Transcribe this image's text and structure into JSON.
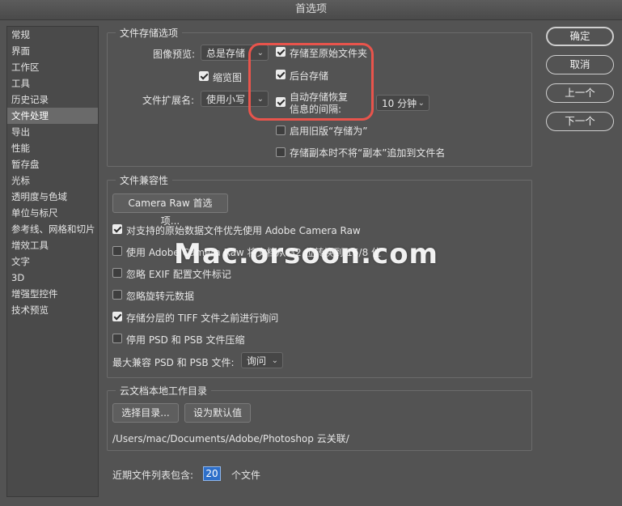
{
  "window": {
    "title": "首选项"
  },
  "sidebar": {
    "items": [
      {
        "label": "常规"
      },
      {
        "label": "界面"
      },
      {
        "label": "工作区"
      },
      {
        "label": "工具"
      },
      {
        "label": "历史记录"
      },
      {
        "label": "文件处理"
      },
      {
        "label": "导出"
      },
      {
        "label": "性能"
      },
      {
        "label": "暂存盘"
      },
      {
        "label": "光标"
      },
      {
        "label": "透明度与色域"
      },
      {
        "label": "单位与标尺"
      },
      {
        "label": "参考线、网格和切片"
      },
      {
        "label": "增效工具"
      },
      {
        "label": "文字"
      },
      {
        "label": "3D"
      },
      {
        "label": "增强型控件"
      },
      {
        "label": "技术预览"
      }
    ],
    "active_index": 5
  },
  "file_saving": {
    "title": "文件存储选项",
    "image_preview_label": "图像预览:",
    "image_preview_value": "总是存储",
    "thumbnail_label": "缩览图",
    "thumbnail_checked": true,
    "file_ext_label": "文件扩展名:",
    "file_ext_value": "使用小写",
    "save_original_folder_label": "存储至原始文件夹",
    "save_original_folder_checked": true,
    "background_save_label": "后台存储",
    "background_save_checked": true,
    "auto_save_label_line1": "自动存储恢复",
    "auto_save_label_line2": "信息的间隔:",
    "auto_save_checked": true,
    "auto_save_interval": "10 分钟",
    "legacy_save_as_label": "启用旧版“存储为”",
    "legacy_save_as_checked": false,
    "no_copy_suffix_label": "存储副本时不将“副本”追加到文件名",
    "no_copy_suffix_checked": false
  },
  "compat": {
    "title": "文件兼容性",
    "camera_raw_button": "Camera Raw 首选项...",
    "opt1_label": "对支持的原始数据文件优先使用 Adobe Camera Raw",
    "opt1_checked": true,
    "opt2_label": "使用 Adobe Camera Raw 将文档从 32 位转换到 16/8 位",
    "opt2_checked": false,
    "opt3_label": "忽略 EXIF 配置文件标记",
    "opt3_checked": false,
    "opt4_label": "忽略旋转元数据",
    "opt4_checked": false,
    "opt5_label": "存储分层的 TIFF 文件之前进行询问",
    "opt5_checked": true,
    "opt6_label": "停用 PSD 和 PSB 文件压缩",
    "opt6_checked": false,
    "max_compat_label": "最大兼容 PSD 和 PSB 文件:",
    "max_compat_value": "询问"
  },
  "cloud": {
    "title": "云文档本地工作目录",
    "choose_dir_button": "选择目录...",
    "set_default_button": "设为默认值",
    "path": "/Users/mac/Documents/Adobe/Photoshop 云关联/"
  },
  "recent": {
    "label": "近期文件列表包含:",
    "value": "20",
    "suffix": "个文件"
  },
  "buttons": {
    "ok": "确定",
    "cancel": "取消",
    "prev": "上一个",
    "next": "下一个"
  },
  "watermark": {
    "text": "Mac.orsoon.com"
  },
  "colors": {
    "highlight": "#e8544c",
    "field_selected": "#2e6fc9"
  }
}
